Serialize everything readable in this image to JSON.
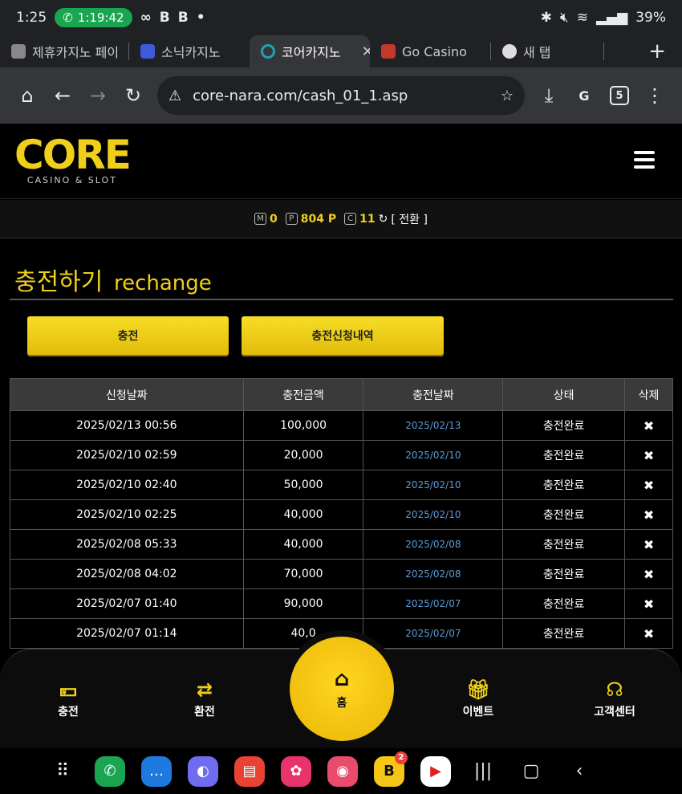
{
  "status_bar": {
    "time": "1:25",
    "call_timer": "1:19:42",
    "battery": "39%"
  },
  "tabs": [
    {
      "label": "제휴카지노 페이",
      "favicon_color": "#888888"
    },
    {
      "label": "소닉카지노",
      "favicon_color": "#3b5bdb"
    },
    {
      "label": "코어카지노",
      "favicon_color": "#1fa3b5",
      "active": true
    },
    {
      "label": "Go Casino",
      "favicon_color": "#c0392b"
    },
    {
      "label": "새 탭",
      "favicon_color": "#dddddd"
    }
  ],
  "browser": {
    "url": "core-nara.com/cash_01_1.asp",
    "tab_count": "5"
  },
  "site": {
    "logo_text": "CORE",
    "logo_sub": "CASINO & SLOT"
  },
  "points": {
    "m_badge": "M",
    "m_value": "0",
    "p_badge": "P",
    "p_value": "804 P",
    "c_badge": "C",
    "c_value": "11",
    "switch_label": "[ 전환 ]"
  },
  "page": {
    "title_ko": "충전하기",
    "title_en": "rechange",
    "btn_charge": "충전",
    "btn_history": "충전신청내역"
  },
  "table": {
    "headers": [
      "신청날짜",
      "충전금액",
      "충전날짜",
      "상태",
      "삭제"
    ],
    "rows": [
      {
        "req": "2025/02/13 00:56",
        "amount": "100,000",
        "date": "2025/02/13",
        "status": "충전완료"
      },
      {
        "req": "2025/02/10 02:59",
        "amount": "20,000",
        "date": "2025/02/10",
        "status": "충전완료"
      },
      {
        "req": "2025/02/10 02:40",
        "amount": "50,000",
        "date": "2025/02/10",
        "status": "충전완료"
      },
      {
        "req": "2025/02/10 02:25",
        "amount": "40,000",
        "date": "2025/02/10",
        "status": "충전완료"
      },
      {
        "req": "2025/02/08 05:33",
        "amount": "40,000",
        "date": "2025/02/08",
        "status": "충전완료"
      },
      {
        "req": "2025/02/08 04:02",
        "amount": "70,000",
        "date": "2025/02/08",
        "status": "충전완료"
      },
      {
        "req": "2025/02/07 01:40",
        "amount": "90,000",
        "date": "2025/02/07",
        "status": "충전완료"
      },
      {
        "req": "2025/02/07 01:14",
        "amount": "40,0",
        "date": "2025/02/07",
        "status": "충전완료"
      }
    ],
    "delete_glyph": "✖"
  },
  "bottom_nav": {
    "charge": "충전",
    "exchange": "환전",
    "home": "홈",
    "event": "이벤트",
    "support": "고객센터"
  },
  "dock": {
    "badge_count": "2"
  },
  "colors": {
    "accent": "#f0cf1a",
    "link": "#5b9bd5"
  }
}
